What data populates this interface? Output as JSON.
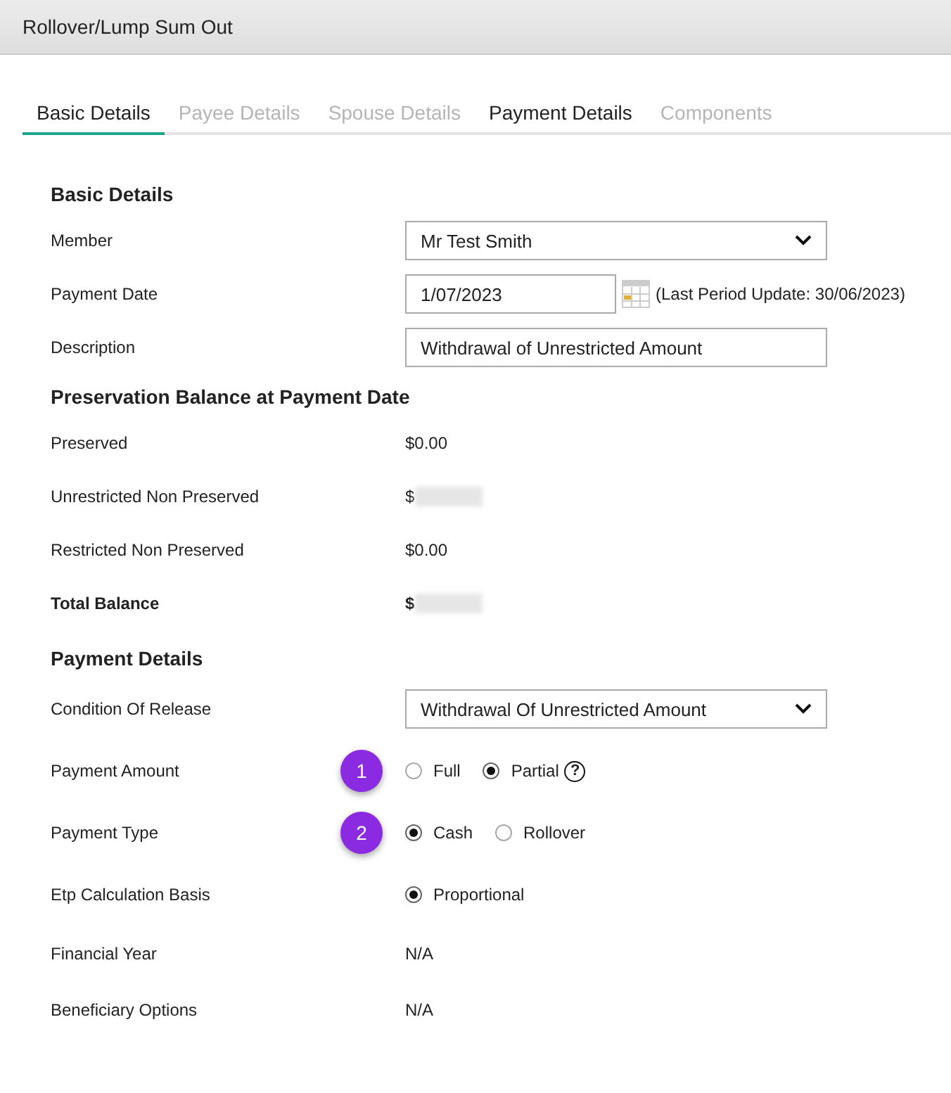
{
  "window": {
    "title": "Rollover/Lump Sum Out"
  },
  "tabs": [
    {
      "label": "Basic Details",
      "selected": true,
      "disabled": false
    },
    {
      "label": "Payee Details",
      "selected": false,
      "disabled": true
    },
    {
      "label": "Spouse Details",
      "selected": false,
      "disabled": true
    },
    {
      "label": "Payment Details",
      "selected": false,
      "disabled": false
    },
    {
      "label": "Components",
      "selected": false,
      "disabled": true
    }
  ],
  "sections": [
    {
      "title": "Basic Details",
      "rows": [
        {
          "label": "Member",
          "kind": "select",
          "value": "Mr Test Smith"
        },
        {
          "label": "Payment Date",
          "kind": "date",
          "value": "1/07/2023",
          "note": "(Last Period Update: 30/06/2023)"
        },
        {
          "label": "Description",
          "kind": "text",
          "value": "Withdrawal of Unrestricted Amount"
        }
      ]
    },
    {
      "title": "Preservation Balance at Payment Date",
      "rows": [
        {
          "label": "Preserved",
          "kind": "value",
          "value": "$0.00",
          "redacted": false
        },
        {
          "label": "Unrestricted Non Preserved",
          "kind": "value",
          "value": "$",
          "redacted": true
        },
        {
          "label": "Restricted Non Preserved",
          "kind": "value",
          "value": "$0.00",
          "redacted": false
        },
        {
          "label": "Total Balance",
          "kind": "value",
          "value": "$",
          "redacted": true,
          "bold": true
        }
      ]
    },
    {
      "title": "Payment Details",
      "rows": [
        {
          "label": "Condition Of Release",
          "kind": "select",
          "value": "Withdrawal Of Unrestricted Amount"
        },
        {
          "label": "Payment Amount",
          "kind": "radios",
          "badge": "1",
          "help": "?",
          "options": [
            {
              "label": "Full",
              "selected": false
            },
            {
              "label": "Partial",
              "selected": true
            }
          ]
        },
        {
          "label": "Payment Type",
          "kind": "radios",
          "badge": "2",
          "options": [
            {
              "label": "Cash",
              "selected": true
            },
            {
              "label": "Rollover",
              "selected": false
            }
          ]
        },
        {
          "label": "Etp Calculation Basis",
          "kind": "radios",
          "options": [
            {
              "label": "Proportional",
              "selected": true
            }
          ]
        },
        {
          "label": "Financial Year",
          "kind": "value",
          "value": "N/A",
          "redacted": false
        },
        {
          "label": "Beneficiary Options",
          "kind": "value",
          "value": "N/A",
          "redacted": false
        }
      ]
    }
  ]
}
